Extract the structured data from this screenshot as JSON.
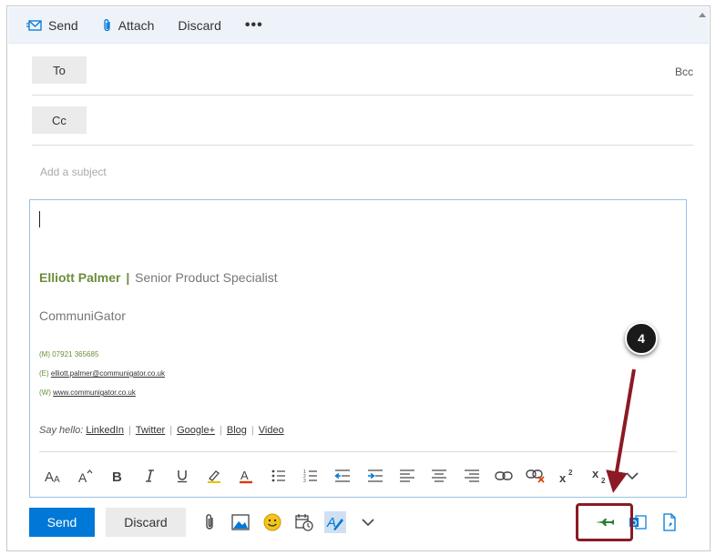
{
  "toolbar": {
    "send_label": "Send",
    "attach_label": "Attach",
    "discard_label": "Discard",
    "more_label": "•••"
  },
  "recipients": {
    "to_label": "To",
    "cc_label": "Cc",
    "bcc_label": "Bcc"
  },
  "subject": {
    "placeholder": "Add a subject"
  },
  "signature": {
    "name": "Elliott Palmer",
    "separator": "|",
    "role": "Senior Product Specialist",
    "company": "CommuniGator",
    "mobile_prefix": "(M)",
    "mobile": "07921 365685",
    "email_prefix": "(E)",
    "email": "elliott.palmer@communigator.co.uk",
    "web_prefix": "(W)",
    "web": "www.communigator.co.uk",
    "say_hello": "Say hello:",
    "links": [
      "LinkedIn",
      "Twitter",
      "Google+",
      "Blog",
      "Video"
    ],
    "link_separator": "|"
  },
  "formatting_icons": [
    "font-size-decrease-icon",
    "font-size-increase-icon",
    "bold-icon",
    "italic-icon",
    "underline-icon",
    "highlight-icon",
    "font-color-icon",
    "bullets-icon",
    "numbering-icon",
    "decrease-indent-icon",
    "increase-indent-icon",
    "align-left-icon",
    "align-center-icon",
    "align-right-icon",
    "insert-link-icon",
    "remove-link-icon",
    "superscript-icon",
    "subscript-icon",
    "more-formatting-chevron-icon"
  ],
  "bottom_bar": {
    "send_label": "Send",
    "discard_label": "Discard",
    "icons": [
      "attach-icon",
      "insert-picture-icon",
      "emoji-icon",
      "schedule-send-icon",
      "formatting-toggle-icon",
      "more-options-chevron-icon",
      "addin-plane-icon",
      "outlook-addin-icon",
      "document-addin-icon"
    ]
  },
  "annotation": {
    "step_number": "4"
  },
  "colors": {
    "accent_blue": "#0078d7",
    "signature_green": "#6b8e3a",
    "highlight_red": "#8b1a24",
    "topbar_bg": "#eef3f9"
  }
}
